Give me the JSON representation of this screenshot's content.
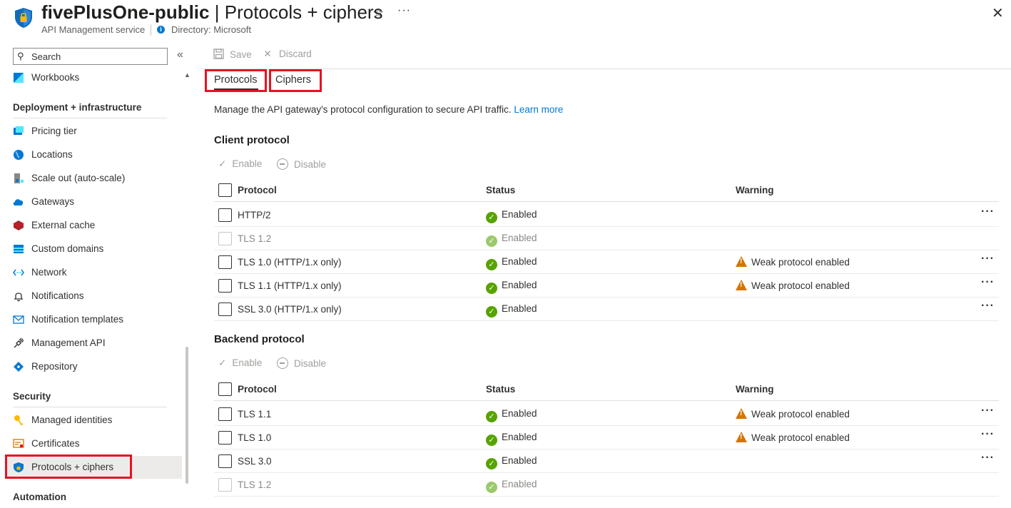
{
  "header": {
    "resource_name": "fivePlusOne-public",
    "page_name": "Protocols + ciphers",
    "separator": "|",
    "service_type": "API Management service",
    "directory": "Directory: Microsoft",
    "icons": {
      "app": "shield-lock-icon",
      "favorite": "star-icon",
      "more": "more-icon",
      "close": "close-icon"
    }
  },
  "sidebar": {
    "search_placeholder": "Search",
    "top_items": [
      {
        "label": "Workbooks",
        "icon": "workbooks-icon"
      }
    ],
    "sections": [
      {
        "title": "Deployment + infrastructure",
        "items": [
          {
            "label": "Pricing tier",
            "icon": "pricing-tier-icon"
          },
          {
            "label": "Locations",
            "icon": "globe-icon"
          },
          {
            "label": "Scale out (auto-scale)",
            "icon": "scale-out-icon"
          },
          {
            "label": "Gateways",
            "icon": "cloud-gateway-icon"
          },
          {
            "label": "External cache",
            "icon": "cache-icon"
          },
          {
            "label": "Custom domains",
            "icon": "custom-domains-icon"
          },
          {
            "label": "Network",
            "icon": "network-icon"
          },
          {
            "label": "Notifications",
            "icon": "bell-icon"
          },
          {
            "label": "Notification templates",
            "icon": "mail-icon"
          },
          {
            "label": "Management API",
            "icon": "plug-icon"
          },
          {
            "label": "Repository",
            "icon": "git-icon"
          }
        ]
      },
      {
        "title": "Security",
        "items": [
          {
            "label": "Managed identities",
            "icon": "key-icon"
          },
          {
            "label": "Certificates",
            "icon": "certificate-icon"
          },
          {
            "label": "Protocols + ciphers",
            "icon": "shield-icon",
            "active": true
          }
        ]
      },
      {
        "title": "Automation",
        "items": []
      }
    ]
  },
  "toolbar": {
    "save": "Save",
    "discard": "Discard"
  },
  "tabs": [
    {
      "label": "Protocols",
      "active": true
    },
    {
      "label": "Ciphers",
      "active": false
    }
  ],
  "description": {
    "text": "Manage the API gateway's protocol configuration to secure API traffic.",
    "link": "Learn more"
  },
  "commands": {
    "enable": "Enable",
    "disable": "Disable"
  },
  "columns": {
    "protocol": "Protocol",
    "status": "Status",
    "warning": "Warning"
  },
  "client_protocol": {
    "title": "Client protocol",
    "rows": [
      {
        "protocol": "HTTP/2",
        "status": "Enabled",
        "warning": "",
        "disabled": false
      },
      {
        "protocol": "TLS 1.2",
        "status": "Enabled",
        "warning": "",
        "disabled": true
      },
      {
        "protocol": "TLS 1.0 (HTTP/1.x only)",
        "status": "Enabled",
        "warning": "Weak protocol enabled",
        "disabled": false
      },
      {
        "protocol": "TLS 1.1 (HTTP/1.x only)",
        "status": "Enabled",
        "warning": "Weak protocol enabled",
        "disabled": false
      },
      {
        "protocol": "SSL 3.0 (HTTP/1.x only)",
        "status": "Enabled",
        "warning": "",
        "disabled": false
      }
    ]
  },
  "backend_protocol": {
    "title": "Backend protocol",
    "rows": [
      {
        "protocol": "TLS 1.1",
        "status": "Enabled",
        "warning": "Weak protocol enabled",
        "disabled": false
      },
      {
        "protocol": "TLS 1.0",
        "status": "Enabled",
        "warning": "Weak protocol enabled",
        "disabled": false
      },
      {
        "protocol": "SSL 3.0",
        "status": "Enabled",
        "warning": "",
        "disabled": false
      },
      {
        "protocol": "TLS 1.2",
        "status": "Enabled",
        "warning": "",
        "disabled": true
      }
    ]
  },
  "colors": {
    "accent": "#0078d4",
    "success": "#57a300",
    "warning": "#d47500",
    "highlight": "#e81123"
  }
}
